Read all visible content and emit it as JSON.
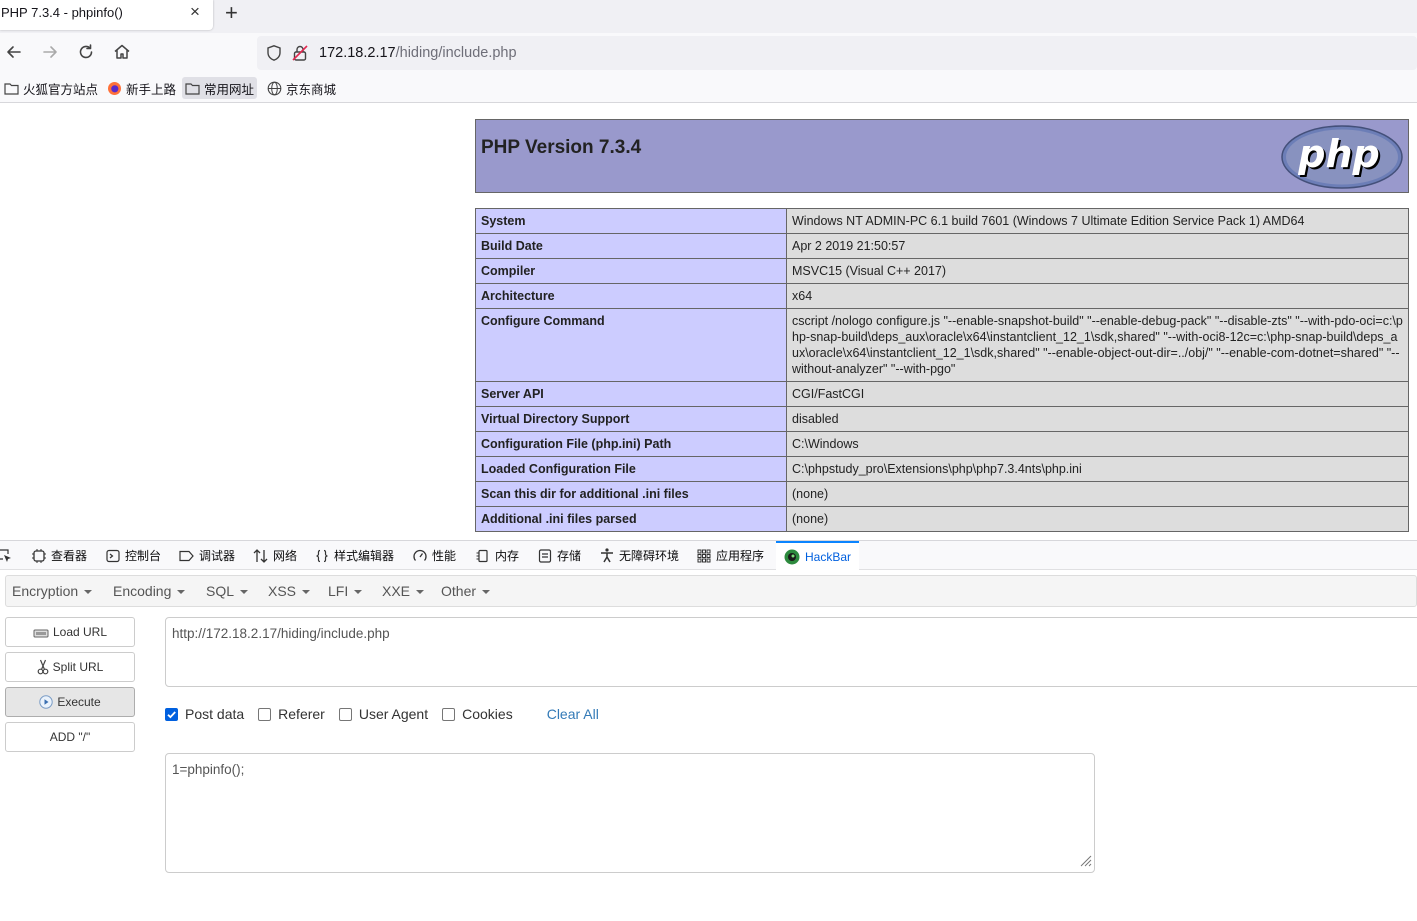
{
  "tab": {
    "title": "PHP 7.3.4 - phpinfo()",
    "close": "×",
    "new_tab": "+"
  },
  "urlbar": {
    "host": "172.18.2.17",
    "path": "/hiding/include.php"
  },
  "bookmarks": [
    {
      "label": "火狐官方站点",
      "icon": "folder-icon"
    },
    {
      "label": "新手上路",
      "icon": "firefox-icon"
    },
    {
      "label": "常用网址",
      "icon": "folder-icon"
    },
    {
      "label": "京东商城",
      "icon": "globe-icon"
    }
  ],
  "phpinfo": {
    "title": "PHP Version 7.3.4",
    "rows": [
      {
        "key": "System",
        "value": "Windows NT ADMIN-PC 6.1 build 7601 (Windows 7 Ultimate Edition Service Pack 1) AMD64"
      },
      {
        "key": "Build Date",
        "value": "Apr 2 2019 21:50:57"
      },
      {
        "key": "Compiler",
        "value": "MSVC15 (Visual C++ 2017)"
      },
      {
        "key": "Architecture",
        "value": "x64"
      },
      {
        "key": "Configure Command",
        "value": "cscript /nologo configure.js \"--enable-snapshot-build\" \"--enable-debug-pack\" \"--disable-zts\" \"--with-pdo-oci=c:\\php-snap-build\\deps_aux\\oracle\\x64\\instantclient_12_1\\sdk,shared\" \"--with-oci8-12c=c:\\php-snap-build\\deps_aux\\oracle\\x64\\instantclient_12_1\\sdk,shared\" \"--enable-object-out-dir=../obj/\" \"--enable-com-dotnet=shared\" \"--without-analyzer\" \"--with-pgo\""
      },
      {
        "key": "Server API",
        "value": "CGI/FastCGI"
      },
      {
        "key": "Virtual Directory Support",
        "value": "disabled"
      },
      {
        "key": "Configuration File (php.ini) Path",
        "value": "C:\\Windows"
      },
      {
        "key": "Loaded Configuration File",
        "value": "C:\\phpstudy_pro\\Extensions\\php\\php7.3.4nts\\php.ini"
      },
      {
        "key": "Scan this dir for additional .ini files",
        "value": "(none)"
      },
      {
        "key": "Additional .ini files parsed",
        "value": "(none)"
      }
    ]
  },
  "devtools": {
    "tabs": [
      "查看器",
      "控制台",
      "调试器",
      "网络",
      "样式编辑器",
      "性能",
      "内存",
      "存储",
      "无障碍环境",
      "应用程序",
      "HackBar"
    ],
    "selected": "HackBar"
  },
  "hackbar": {
    "menu": [
      "Encryption",
      "Encoding",
      "SQL",
      "XSS",
      "LFI",
      "XXE",
      "Other"
    ],
    "buttons": {
      "load": "Load URL",
      "split": "Split URL",
      "execute": "Execute",
      "add": "ADD \"/\""
    },
    "url": "http://172.18.2.17/hiding/include.php",
    "checks": {
      "post": "Post data",
      "referer": "Referer",
      "ua": "User Agent",
      "cookies": "Cookies",
      "clear": "Clear All"
    },
    "post_checked": true,
    "post_body": "1=phpinfo();"
  },
  "colors": {
    "php_header": "#9999cc",
    "key_cell": "#ccccff",
    "value_cell": "#dddddd",
    "accent": "#0060df"
  }
}
